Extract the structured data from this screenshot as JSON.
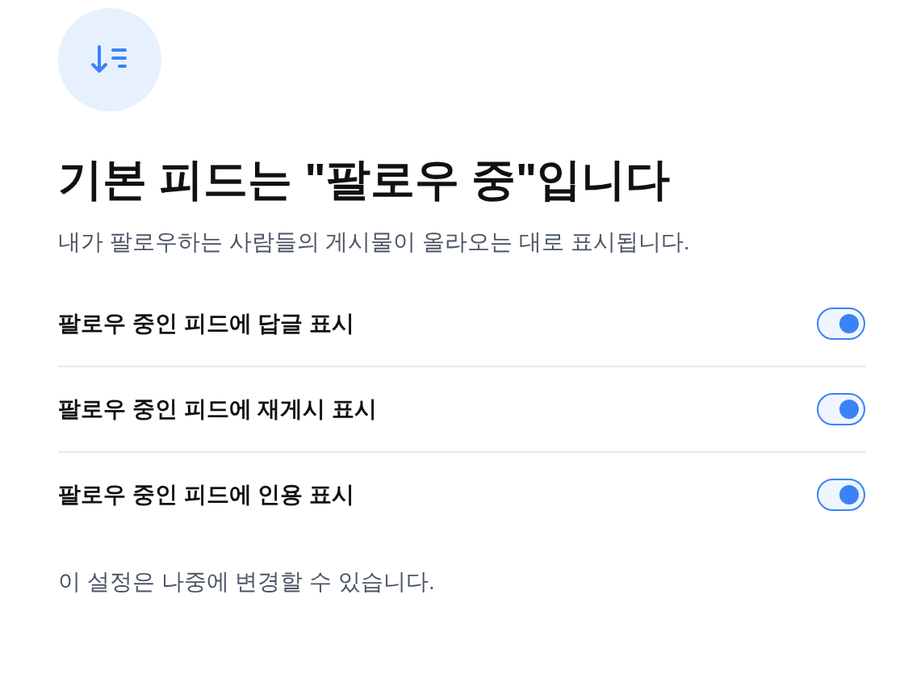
{
  "header": {
    "title": "기본 피드는 \"팔로우 중\"입니다",
    "subtitle": "내가 팔로우하는 사람들의 게시물이 올라오는 대로 표시됩니다."
  },
  "settings": [
    {
      "label": "팔로우 중인 피드에 답글 표시",
      "on": true
    },
    {
      "label": "팔로우 중인 피드에 재게시 표시",
      "on": true
    },
    {
      "label": "팔로우 중인 피드에 인용 표시",
      "on": true
    }
  ],
  "footer_note": "이 설정은 나중에 변경할 수 있습니다."
}
